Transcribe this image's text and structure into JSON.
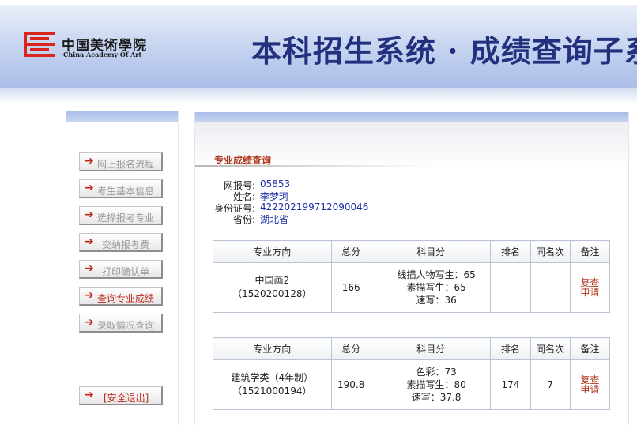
{
  "header": {
    "logo_cn": "中国美術學院",
    "logo_en": "China Academy Of Art",
    "title": "本科招生系统 · 成绩查询子系统"
  },
  "sidebar": {
    "items": [
      {
        "label": "网上报名流程",
        "active": false
      },
      {
        "label": "考生基本信息",
        "active": false
      },
      {
        "label": "选择报考专业",
        "active": false
      },
      {
        "label": "交纳报考费",
        "active": false
      },
      {
        "label": "打印确认单",
        "active": false
      },
      {
        "label": "查询专业成绩",
        "active": true
      },
      {
        "label": "录取情况查询",
        "active": false
      }
    ],
    "logout_label": "[安全退出]"
  },
  "main": {
    "section_title": "专业成绩查询",
    "info": [
      {
        "label": "网报号:",
        "value": "05853"
      },
      {
        "label": "姓名:",
        "value": "李梦珂"
      },
      {
        "label": "身份证号:",
        "value": "422202199712090046"
      },
      {
        "label": "省份:",
        "value": "湖北省"
      }
    ],
    "columns": [
      "专业方向",
      "总分",
      "科目分",
      "排名",
      "同名次",
      "备注"
    ],
    "results": [
      {
        "major": "中国画2",
        "code": "（1520200128）",
        "total": "166",
        "subjects": [
          "线描人物写生：65",
          "素描写生：65",
          "速写：36"
        ],
        "rank": "",
        "same_rank": "",
        "remark": [
          "复查",
          "申请"
        ]
      },
      {
        "major": "建筑学类（4年制）",
        "code": "（1521000194）",
        "total": "190.8",
        "subjects": [
          "色彩：73",
          "素描写生：80",
          "速写：37.8"
        ],
        "rank": "174",
        "same_rank": "7",
        "remark": [
          "复查",
          "申请"
        ]
      }
    ]
  },
  "colors": {
    "accent_red": "#c0251b",
    "title_blue": "#23307d",
    "value_blue": "#1f2fa8",
    "header_light": "#c5d3f0"
  }
}
